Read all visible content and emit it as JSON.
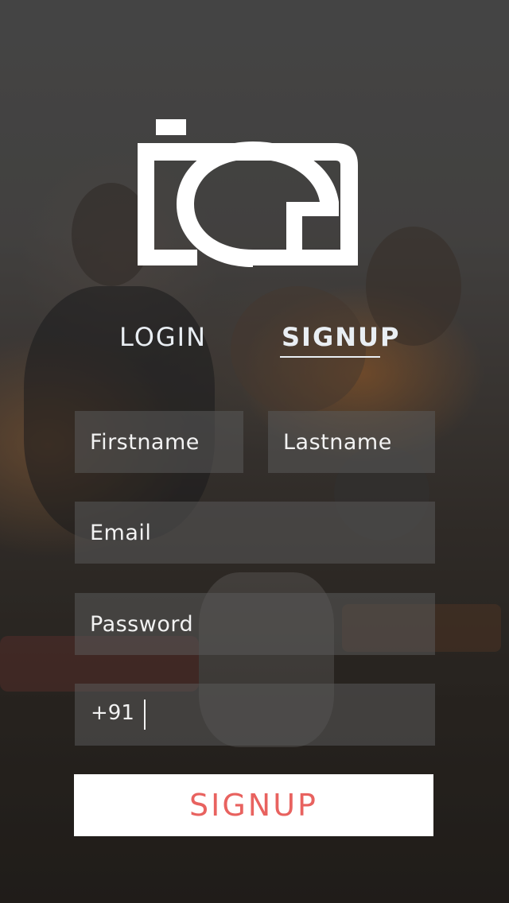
{
  "tabs": {
    "login_label": "LOGIN",
    "signup_label": "SIGNUP",
    "active": "SIGNUP"
  },
  "form": {
    "firstname_placeholder": "Firstname",
    "lastname_placeholder": "Lastname",
    "email_placeholder": "Email",
    "password_placeholder": "Password",
    "phone_prefix": "+91",
    "phone_value": ""
  },
  "signup_button_label": "SIGNUP",
  "colors": {
    "accent": "#e8625f",
    "tab_text": "#e9eef3",
    "field_bg": "rgba(90,90,90,0.55)",
    "button_bg": "#ffffff"
  },
  "icons": {
    "logo": "camera-logo-icon"
  }
}
